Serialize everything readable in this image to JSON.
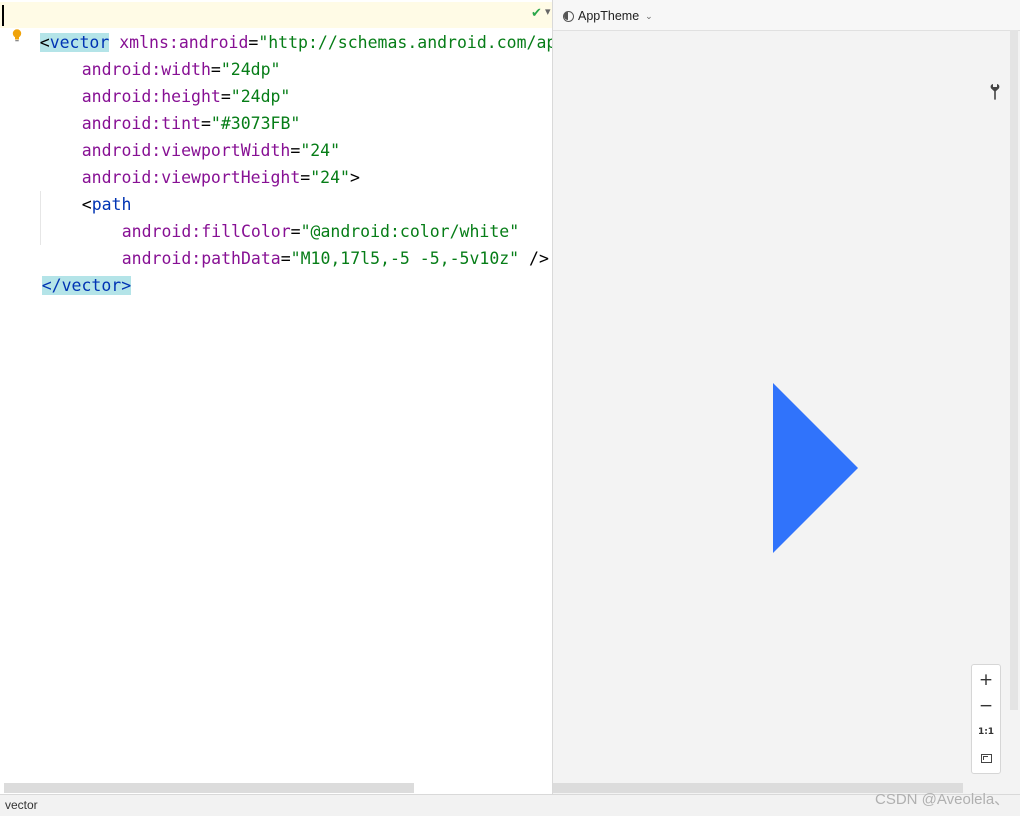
{
  "editor": {
    "line1": {
      "open": "<",
      "tag": "vector",
      "attr": "xmlns:android",
      "eq": "=",
      "value": "\"http://schemas.android.com/apk"
    },
    "line2": {
      "attr": "android:width",
      "eq": "=",
      "value": "\"24dp\""
    },
    "line3": {
      "attr": "android:height",
      "eq": "=",
      "value": "\"24dp\""
    },
    "line4": {
      "attr": "android:tint",
      "eq": "=",
      "value": "\"#3073FB\""
    },
    "line5": {
      "attr": "android:viewportWidth",
      "eq": "=",
      "value": "\"24\""
    },
    "line6": {
      "attr": "android:viewportHeight",
      "eq": "=",
      "value": "\"24\"",
      "close": ">"
    },
    "line7": {
      "open": "<",
      "tag": "path"
    },
    "line8": {
      "attr": "android:fillColor",
      "eq": "=",
      "value": "\"@android:color/white\""
    },
    "line9": {
      "attr": "android:pathData",
      "eq": "=",
      "value": "\"M10,17l5,-5 -5,-5v10z\"",
      "close": " />"
    },
    "line10": {
      "close_tag": "</vector>"
    }
  },
  "icons": {
    "bulb": "lightbulb-icon",
    "check": "checkmark-icon",
    "wrench": "wrench-icon",
    "theme": "theme-icon",
    "zoom_fit": "zoom-to-fit-icon"
  },
  "preview": {
    "theme_label": "AppTheme",
    "tint_color": "#3073FB",
    "zoom": {
      "plus": "+",
      "minus": "−",
      "actual": "1:1"
    }
  },
  "statusbar": {
    "breadcrumb": "vector"
  },
  "watermark": "CSDN @Aveolela、"
}
